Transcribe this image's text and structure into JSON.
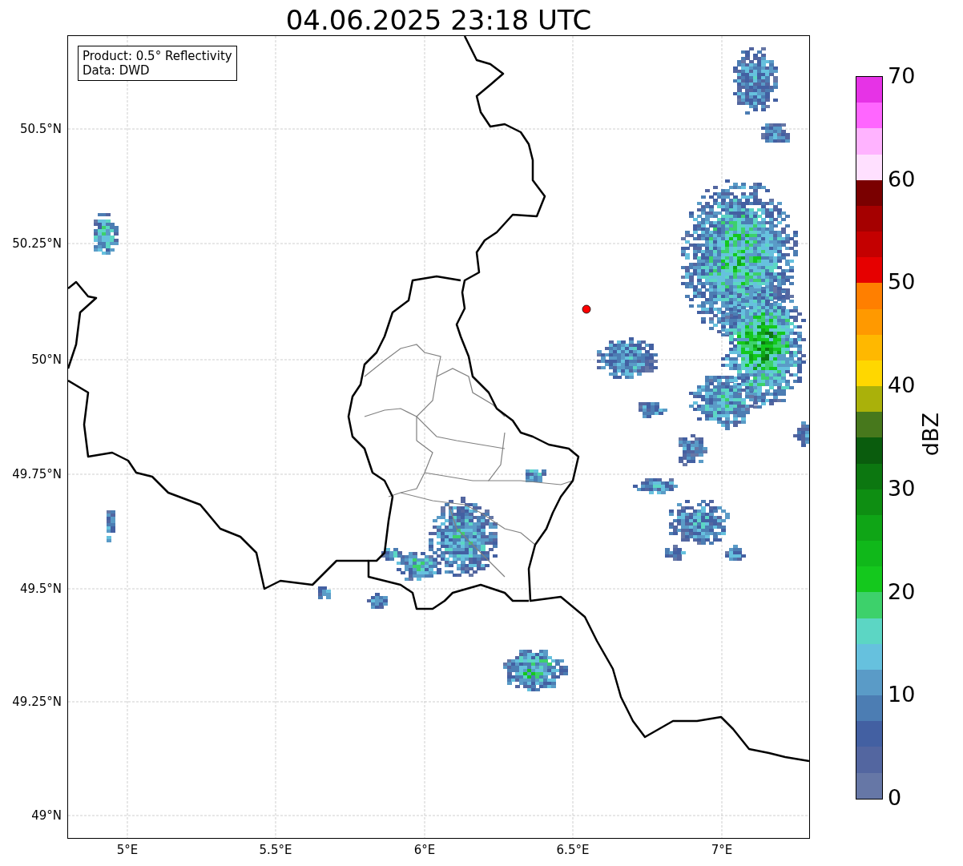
{
  "title": "04.06.2025 23:18 UTC",
  "legend": [
    "Product: 0.5° Reflectivity",
    "Data: DWD"
  ],
  "y_axis": {
    "ticks": [
      "50.5°N",
      "50.25°N",
      "50°N",
      "49.75°N",
      "49.5°N",
      "49.25°N",
      "49°N"
    ]
  },
  "x_axis": {
    "ticks": [
      "5°E",
      "5.5°E",
      "6°E",
      "6.5°E",
      "7°E"
    ]
  },
  "colorbar": {
    "label": "dBZ",
    "ticks": [
      "70",
      "60",
      "50",
      "40",
      "30",
      "20",
      "10",
      "0"
    ],
    "bands": [
      {
        "color": "#e633e6"
      },
      {
        "color": "#ff66ff"
      },
      {
        "color": "#ffb3ff"
      },
      {
        "color": "#ffe0ff"
      },
      {
        "color": "#7a0000"
      },
      {
        "color": "#a50000"
      },
      {
        "color": "#c40000"
      },
      {
        "color": "#e60000"
      },
      {
        "color": "#ff7f00"
      },
      {
        "color": "#ff9900"
      },
      {
        "color": "#ffb800"
      },
      {
        "color": "#ffd700"
      },
      {
        "color": "#aab10a"
      },
      {
        "color": "#47781c"
      },
      {
        "color": "#0a5c0d"
      },
      {
        "color": "#0c7710"
      },
      {
        "color": "#0e8e12"
      },
      {
        "color": "#0fa516"
      },
      {
        "color": "#10b81a"
      },
      {
        "color": "#14c81d"
      },
      {
        "color": "#3dd16b"
      },
      {
        "color": "#5cd6c4"
      },
      {
        "color": "#66c1de"
      },
      {
        "color": "#5a9bc7"
      },
      {
        "color": "#4c7db3"
      },
      {
        "color": "#4360a2"
      },
      {
        "color": "#5366a0"
      },
      {
        "color": "#6677a6"
      }
    ]
  }
}
